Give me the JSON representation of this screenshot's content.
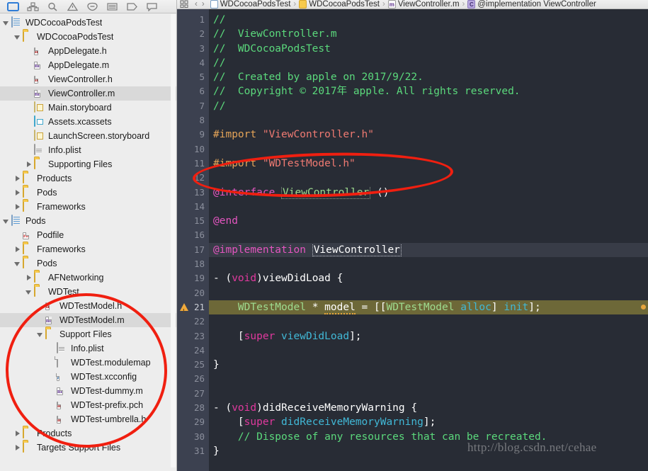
{
  "navigator": {
    "toolbar_icons": [
      {
        "name": "project-navigator-icon",
        "selected": true
      },
      {
        "name": "source-control-navigator-icon",
        "selected": false
      },
      {
        "name": "search-navigator-icon",
        "selected": false
      },
      {
        "name": "issue-navigator-icon",
        "selected": false
      },
      {
        "name": "test-navigator-icon",
        "selected": false
      },
      {
        "name": "debug-navigator-icon",
        "selected": false
      },
      {
        "name": "breakpoint-navigator-icon",
        "selected": false
      },
      {
        "name": "report-navigator-icon",
        "selected": false
      }
    ],
    "rows": [
      {
        "label": "WDCocoaPodsTest",
        "indent": 0,
        "tri": "open",
        "icon": "project",
        "selected": false
      },
      {
        "label": "WDCocoaPodsTest",
        "indent": 1,
        "tri": "open",
        "icon": "folder",
        "selected": false
      },
      {
        "label": "AppDelegate.h",
        "indent": 2,
        "tri": "none",
        "icon": "h",
        "selected": false
      },
      {
        "label": "AppDelegate.m",
        "indent": 2,
        "tri": "none",
        "icon": "m",
        "selected": false
      },
      {
        "label": "ViewController.h",
        "indent": 2,
        "tri": "none",
        "icon": "h",
        "selected": false
      },
      {
        "label": "ViewController.m",
        "indent": 2,
        "tri": "none",
        "icon": "m",
        "selected": true
      },
      {
        "label": "Main.storyboard",
        "indent": 2,
        "tri": "none",
        "icon": "storyboard",
        "selected": false
      },
      {
        "label": "Assets.xcassets",
        "indent": 2,
        "tri": "none",
        "icon": "assets",
        "selected": false
      },
      {
        "label": "LaunchScreen.storyboard",
        "indent": 2,
        "tri": "none",
        "icon": "storyboard",
        "selected": false
      },
      {
        "label": "Info.plist",
        "indent": 2,
        "tri": "none",
        "icon": "plist",
        "selected": false
      },
      {
        "label": "Supporting Files",
        "indent": 2,
        "tri": "closed",
        "icon": "folder",
        "selected": false
      },
      {
        "label": "Products",
        "indent": 1,
        "tri": "closed",
        "icon": "folder",
        "selected": false
      },
      {
        "label": "Pods",
        "indent": 1,
        "tri": "closed",
        "icon": "folder",
        "selected": false
      },
      {
        "label": "Frameworks",
        "indent": 1,
        "tri": "closed",
        "icon": "folder",
        "selected": false
      },
      {
        "label": "Pods",
        "indent": 0,
        "tri": "open",
        "icon": "project",
        "selected": false
      },
      {
        "label": "Podfile",
        "indent": 1,
        "tri": "none",
        "icon": "rb",
        "selected": false
      },
      {
        "label": "Frameworks",
        "indent": 1,
        "tri": "closed",
        "icon": "folder",
        "selected": false
      },
      {
        "label": "Pods",
        "indent": 1,
        "tri": "open",
        "icon": "folder",
        "selected": false
      },
      {
        "label": "AFNetworking",
        "indent": 2,
        "tri": "closed",
        "icon": "folder",
        "selected": false
      },
      {
        "label": "WDTest",
        "indent": 2,
        "tri": "open",
        "icon": "folder",
        "selected": false
      },
      {
        "label": "WDTestModel.h",
        "indent": 3,
        "tri": "none",
        "icon": "h",
        "selected": false
      },
      {
        "label": "WDTestModel.m",
        "indent": 3,
        "tri": "none",
        "icon": "m",
        "selected": true
      },
      {
        "label": "Support Files",
        "indent": 3,
        "tri": "open",
        "icon": "folder",
        "selected": false
      },
      {
        "label": "Info.plist",
        "indent": 4,
        "tri": "none",
        "icon": "plist",
        "selected": false
      },
      {
        "label": "WDTest.modulemap",
        "indent": 4,
        "tri": "none",
        "icon": "blank",
        "selected": false
      },
      {
        "label": "WDTest.xcconfig",
        "indent": 4,
        "tri": "none",
        "icon": "xc",
        "selected": false
      },
      {
        "label": "WDTest-dummy.m",
        "indent": 4,
        "tri": "none",
        "icon": "m",
        "selected": false
      },
      {
        "label": "WDTest-prefix.pch",
        "indent": 4,
        "tri": "none",
        "icon": "h",
        "selected": false
      },
      {
        "label": "WDTest-umbrella.h",
        "indent": 4,
        "tri": "none",
        "icon": "h",
        "selected": false
      },
      {
        "label": "Products",
        "indent": 1,
        "tri": "closed",
        "icon": "folder",
        "selected": false
      },
      {
        "label": "Targets Support Files",
        "indent": 1,
        "tri": "closed",
        "icon": "folder",
        "selected": false
      }
    ]
  },
  "jumpbar": {
    "back_label": "‹",
    "forward_label": "›",
    "crumbs": [
      {
        "label": "WDCocoaPodsTest",
        "icon": "project"
      },
      {
        "label": "WDCocoaPodsTest",
        "icon": "folder"
      },
      {
        "label": "ViewController.m",
        "icon": "m"
      },
      {
        "label": "@implementation ViewController",
        "icon": "symbol"
      }
    ],
    "separator": "›"
  },
  "editor": {
    "line_numbers": [
      1,
      2,
      3,
      4,
      5,
      6,
      7,
      8,
      9,
      10,
      11,
      12,
      13,
      14,
      15,
      16,
      17,
      18,
      19,
      20,
      21,
      22,
      23,
      24,
      25,
      26,
      27,
      28,
      29,
      30,
      31
    ],
    "current_line": 17,
    "warning_line": 21,
    "warning_icon": "warning-triangle-icon",
    "lines": [
      {
        "n": 1,
        "html": "<span class=\"c-cmt\">//</span>"
      },
      {
        "n": 2,
        "html": "<span class=\"c-cmt\">//  ViewController.m</span>"
      },
      {
        "n": 3,
        "html": "<span class=\"c-cmt\">//  WDCocoaPodsTest</span>"
      },
      {
        "n": 4,
        "html": "<span class=\"c-cmt\">//</span>"
      },
      {
        "n": 5,
        "html": "<span class=\"c-cmt\">//  Created by apple on 2017/9/22.</span>"
      },
      {
        "n": 6,
        "html": "<span class=\"c-cmt\">//  Copyright © 2017年 apple. All rights reserved.</span>"
      },
      {
        "n": 7,
        "html": "<span class=\"c-cmt\">//</span>"
      },
      {
        "n": 8,
        "html": ""
      },
      {
        "n": 9,
        "html": "<span class=\"c-pre\">#import</span> <span class=\"c-str\">\"ViewController.h\"</span>"
      },
      {
        "n": 10,
        "html": ""
      },
      {
        "n": 11,
        "html": "<span class=\"c-pre\">#import</span> <span class=\"c-str\">\"WDTestModel.h\"</span>"
      },
      {
        "n": 12,
        "html": ""
      },
      {
        "n": 13,
        "html": "<span class=\"c-kw\">@interface</span> <span class=\"underlined-green\">ViewController</span> <span class=\"c-plain\">()</span>"
      },
      {
        "n": 14,
        "html": ""
      },
      {
        "n": 15,
        "html": "<span class=\"c-kw\">@end</span>"
      },
      {
        "n": 16,
        "html": ""
      },
      {
        "n": 17,
        "html": "<span class=\"c-kw\">@implementation</span> <span class=\"underlined\">ViewController</span>"
      },
      {
        "n": 18,
        "html": ""
      },
      {
        "n": 19,
        "html": "<span class=\"c-plain\">- (</span><span class=\"c-kw2\">void</span><span class=\"c-plain\">)viewDidLoad {</span>"
      },
      {
        "n": 20,
        "html": ""
      },
      {
        "n": 21,
        "html": "    <span class=\"c-cls\">WDTestModel</span> <span class=\"c-plain\">* </span><span class=\"c-plain squig\">model</span><span class=\"c-plain\"> = [[</span><span class=\"c-cls\">WDTestModel</span> <span class=\"c-msg\">alloc</span><span class=\"c-plain\">] </span><span class=\"c-msg\">init</span><span class=\"c-plain\">];</span>"
      },
      {
        "n": 22,
        "html": ""
      },
      {
        "n": 23,
        "html": "    <span class=\"c-plain\">[</span><span class=\"c-kw2\">super</span> <span class=\"c-msg\">viewDidLoad</span><span class=\"c-plain\">];</span>"
      },
      {
        "n": 24,
        "html": ""
      },
      {
        "n": 25,
        "html": "<span class=\"c-plain\">}</span>"
      },
      {
        "n": 26,
        "html": ""
      },
      {
        "n": 27,
        "html": ""
      },
      {
        "n": 28,
        "html": "<span class=\"c-plain\">- (</span><span class=\"c-kw2\">void</span><span class=\"c-plain\">)didReceiveMemoryWarning {</span>"
      },
      {
        "n": 29,
        "html": "    <span class=\"c-plain\">[</span><span class=\"c-kw2\">super</span> <span class=\"c-msg\">didReceiveMemoryWarning</span><span class=\"c-plain\">];</span>"
      },
      {
        "n": 30,
        "html": "    <span class=\"c-cmt\">// Dispose of any resources that can be recreated.</span>"
      },
      {
        "n": 31,
        "html": "<span class=\"c-plain\">}</span>"
      }
    ]
  },
  "annotations": {
    "ellipse_import_target": "#import \"WDTestModel.h\"",
    "ellipse_files_target": "Support Files",
    "color": "#f01f10"
  },
  "watermark": {
    "text": "http://blog.csdn.net/cehae"
  },
  "colors": {
    "editor_background": "#282c35",
    "gutter_background": "#3c4150",
    "current_line": "#383c47",
    "warning_line": "#6d6838",
    "sidebar_background": "#ededed",
    "selection": "#d9d9d9",
    "comment": "#5bd97c",
    "keyword": "#e455c0",
    "string": "#ef7a72",
    "preprocessor": "#e5a458",
    "class_name": "#9edb8f",
    "message": "#41b8d6",
    "annotation_red": "#f01f10"
  }
}
